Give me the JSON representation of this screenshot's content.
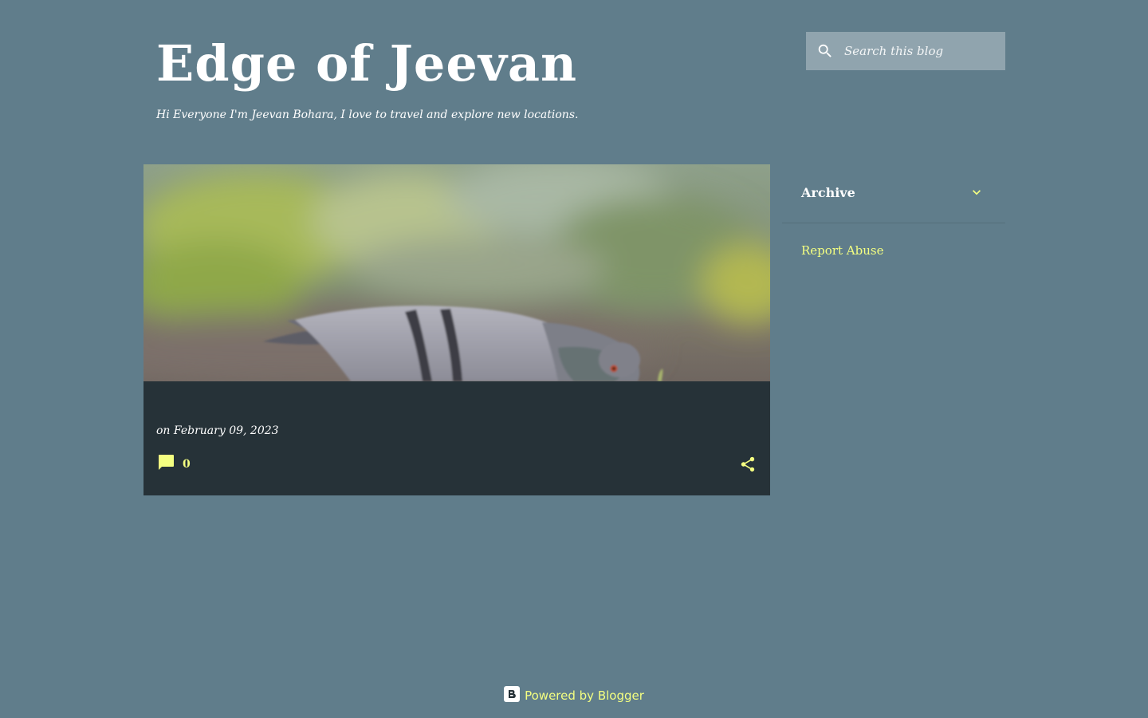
{
  "header": {
    "title": "Edge of Jeevan",
    "description": "Hi Everyone I'm Jeevan Bohara, I love to travel and explore new locations."
  },
  "search": {
    "placeholder": "Search this blog",
    "value": "",
    "icon": "search-icon"
  },
  "post": {
    "image_alt": "pigeon",
    "date_text": "on February 09, 2023",
    "comment_count": "0",
    "comment_icon": "comment-icon",
    "share_icon": "share-icon"
  },
  "sidebar": {
    "archive_title": "Archive",
    "archive_icon": "chevron-down-icon",
    "report_abuse": "Report Abuse"
  },
  "footer": {
    "powered_by": "Powered by Blogger",
    "logo_icon": "blogger-icon"
  },
  "colors": {
    "background": "#607d8b",
    "card": "#263238",
    "accent": "#f4ff81",
    "search_bg": "#90a4ae"
  }
}
